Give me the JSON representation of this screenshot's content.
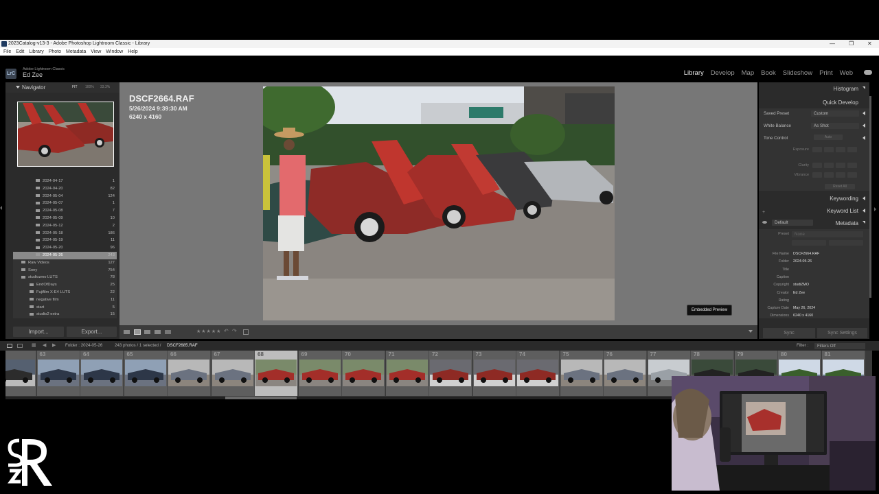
{
  "window": {
    "title": "2023Catalog-v13-3 - Adobe Photoshop Lightroom Classic - Library"
  },
  "menu": [
    "File",
    "Edit",
    "Library",
    "Photo",
    "Metadata",
    "View",
    "Window",
    "Help"
  ],
  "identity": {
    "app_name": "Adobe Lightroom Classic",
    "user": "Ed Zee",
    "badge": "LrC"
  },
  "modules": [
    "Library",
    "Develop",
    "Map",
    "Book",
    "Slideshow",
    "Print",
    "Web"
  ],
  "active_module": "Library",
  "navigator": {
    "title": "Navigator",
    "zoom_options": [
      "FIT",
      "100%",
      "33.3%"
    ]
  },
  "folders": [
    {
      "name": "2024-04-17",
      "count": "1"
    },
    {
      "name": "2024-04-20",
      "count": "82"
    },
    {
      "name": "2024-05-04",
      "count": "124"
    },
    {
      "name": "2024-05-07",
      "count": "1"
    },
    {
      "name": "2024-05-08",
      "count": "7"
    },
    {
      "name": "2024-05-09",
      "count": "10"
    },
    {
      "name": "2024-05-12",
      "count": "2"
    },
    {
      "name": "2024-05-18",
      "count": "186"
    },
    {
      "name": "2024-05-19",
      "count": "11"
    },
    {
      "name": "2024-05-20",
      "count": "96"
    },
    {
      "name": "2024-05-26",
      "count": "243"
    },
    {
      "name": "Raw Videos",
      "count": "127"
    },
    {
      "name": "Sony",
      "count": "754"
    },
    {
      "name": "studiozmo LUTS",
      "count": "78"
    },
    {
      "name": "EndOfDays",
      "count": "25"
    },
    {
      "name": "Fujifilm X-E4 LUTS",
      "count": "22"
    },
    {
      "name": "negative film",
      "count": "11"
    },
    {
      "name": "start",
      "count": "5"
    },
    {
      "name": "studio2 extra",
      "count": "15"
    }
  ],
  "left_buttons": {
    "import": "Import...",
    "export": "Export..."
  },
  "photo_info": {
    "filename": "DSCF2664.RAF",
    "datetime": "5/26/2024 9:39:30 AM",
    "dimensions": "6240 x 4160"
  },
  "preview_badge": "Embedded Preview",
  "right_panel": {
    "histogram": "Histogram",
    "quick_develop": "Quick Develop",
    "saved_preset_label": "Saved Preset",
    "saved_preset_value": "Custom",
    "white_balance_label": "White Balance",
    "white_balance_value": "As Shot",
    "tone_control_label": "Tone Control",
    "tone_auto": "Auto",
    "exposure": "Exposure",
    "clarity": "Clarity",
    "vibrance": "Vibrance",
    "reset_all": "Reset All",
    "keywording": "Keywording",
    "keyword_list": "Keyword List",
    "metadata": "Metadata",
    "metadata_view": "Default",
    "preset_label": "Preset",
    "preset_value": "None",
    "fields": [
      {
        "key": "File Name",
        "value": "DSCF2664.RAF"
      },
      {
        "key": "Folder",
        "value": "2024-05-26"
      },
      {
        "key": "Title",
        "value": ""
      },
      {
        "key": "Caption",
        "value": ""
      },
      {
        "key": "Copyright",
        "value": "studiZMO"
      },
      {
        "key": "Creator",
        "value": "Ed Zee"
      },
      {
        "key": "Rating",
        "value": ""
      },
      {
        "key": "Capture Date",
        "value": "May 26, 2024"
      },
      {
        "key": "Dimensions",
        "value": "6240 x 4160"
      }
    ],
    "sync": "Sync",
    "sync_settings": "Sync Settings"
  },
  "filmstrip_bar": {
    "folder": "Folder : 2024-05-26",
    "count": "243 photos / 1 selected /",
    "selected_file": "DSCF2685.RAF",
    "filter_label": "Filter :",
    "filter_value": "Filters Off"
  },
  "filmstrip": [
    {
      "num": "",
      "kind": "street"
    },
    {
      "num": "63",
      "kind": "cars"
    },
    {
      "num": "64",
      "kind": "cars"
    },
    {
      "num": "65",
      "kind": "cars"
    },
    {
      "num": "66",
      "kind": "lot"
    },
    {
      "num": "67",
      "kind": "lot"
    },
    {
      "num": "68",
      "kind": "red",
      "selected": true
    },
    {
      "num": "69",
      "kind": "red"
    },
    {
      "num": "70",
      "kind": "red"
    },
    {
      "num": "71",
      "kind": "red"
    },
    {
      "num": "72",
      "kind": "wheel"
    },
    {
      "num": "73",
      "kind": "wheel"
    },
    {
      "num": "74",
      "kind": "wheel"
    },
    {
      "num": "75",
      "kind": "lot"
    },
    {
      "num": "76",
      "kind": "lot"
    },
    {
      "num": "77",
      "kind": "silver"
    },
    {
      "num": "78",
      "kind": "dark"
    },
    {
      "num": "79",
      "kind": "dark"
    },
    {
      "num": "80",
      "kind": "sky"
    },
    {
      "num": "81",
      "kind": "sky"
    }
  ],
  "colors": {
    "panel": "#2b2b2b",
    "center_bg": "#777777",
    "selected_folder": "#8a8a8a"
  }
}
